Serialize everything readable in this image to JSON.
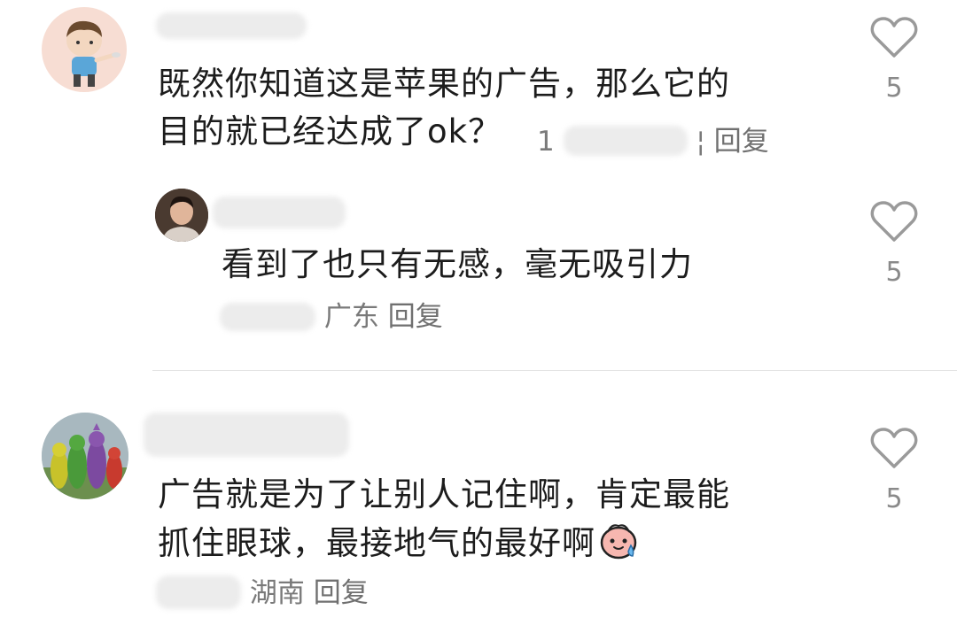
{
  "comments": [
    {
      "text_line1": "既然你知道这是苹果的广告，那么它的",
      "text_line2": "目的就已经达成了ok？",
      "meta_partial": "1",
      "meta_partial_tail": "¦",
      "reply_label": "回复",
      "likes": "5"
    },
    {
      "text": "看到了也只有无感，毫无吸引力",
      "location": "广东",
      "reply_label": "回复",
      "likes": "5"
    },
    {
      "text_line1": "广告就是为了让别人记住啊，肯定最能",
      "text_line2": "抓住眼球，最接地气的最好啊",
      "emoji": "sweat-smile-emoji",
      "location": "湖南",
      "reply_label": "回复",
      "likes": "5"
    }
  ],
  "icons": {
    "like": "heart-outline-icon"
  },
  "colors": {
    "text": "#1c1c1c",
    "meta": "#7a7a7a",
    "heart": "#9a9a9a",
    "divider": "#e4e4e4"
  }
}
